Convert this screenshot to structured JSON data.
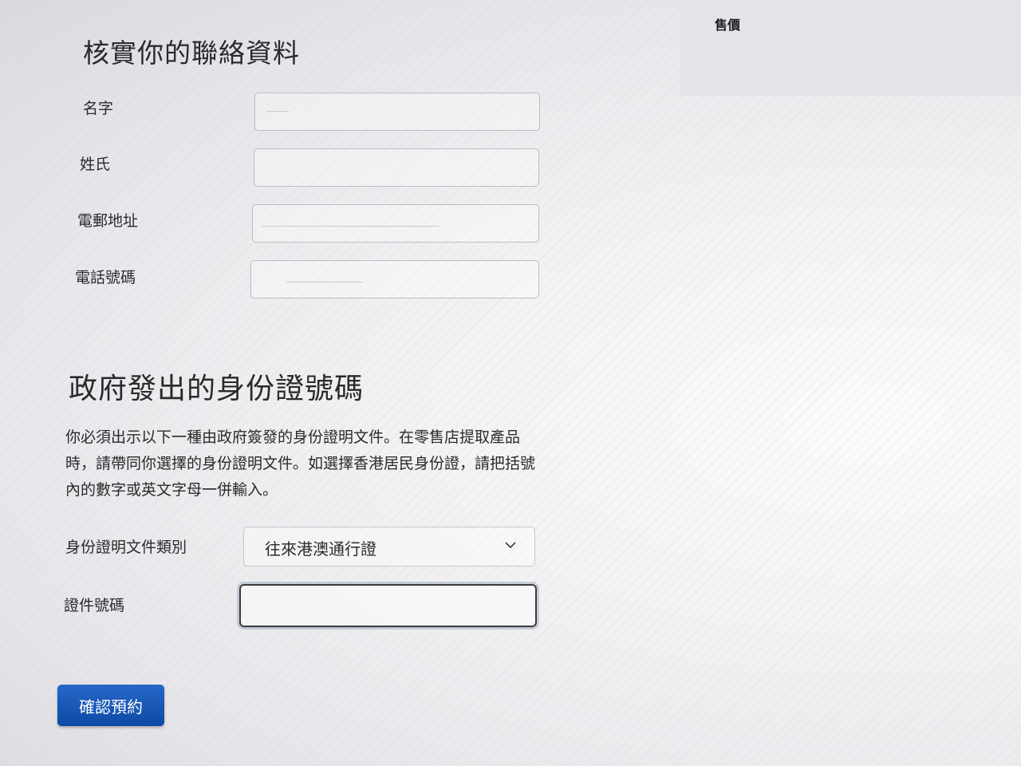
{
  "summary": {
    "price_label": "售價"
  },
  "contact": {
    "title": "核實你的聯絡資料",
    "fields": [
      {
        "label": "名字",
        "value": ""
      },
      {
        "label": "姓氏",
        "value": ""
      },
      {
        "label": "電郵地址",
        "value": ""
      },
      {
        "label": "電話號碼",
        "value": ""
      }
    ]
  },
  "government_id": {
    "title": "政府發出的身份證號碼",
    "description": "你必須出示以下一種由政府簽發的身份證明文件。在零售店提取產品時，請帶同你選擇的身份證明文件。如選擇香港居民身份證，請把括號內的數字或英文字母一併輸入。",
    "type_label": "身份證明文件類別",
    "type_selected": "往來港澳通行證",
    "number_label": "證件號碼",
    "number_value": ""
  },
  "actions": {
    "confirm_label": "確認預約"
  }
}
